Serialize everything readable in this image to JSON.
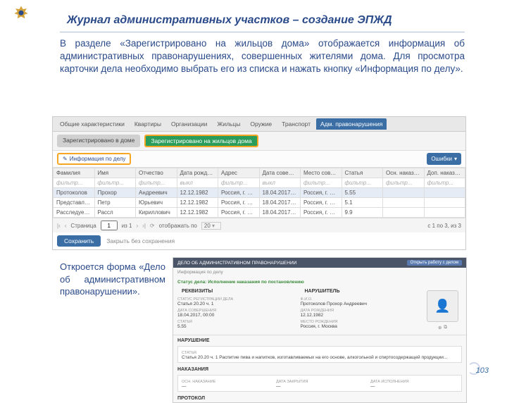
{
  "page": {
    "title": "Журнал административных участков – создание ЭПЖД",
    "number": "103"
  },
  "intro": "В разделе «Зарегистрировано на жильцов дома» отображается информация об  административных правонарушениях, совершенных жителями дома. Для просмотра карточки дела необходимо выбрать его из списка и нажать кнопку «Информация по делу».",
  "desc2": "Откроется форма «Дело об административном правонарушении».",
  "shot1": {
    "tabs": [
      "Общие характеристики",
      "Квартиры",
      "Организации",
      "Жильцы",
      "Оружие",
      "Транспорт",
      "Адм. правонарушения"
    ],
    "activeTab": 6,
    "subtabs": [
      "Зарегистрировано в доме",
      "Зарегистрировано на жильцов дома"
    ],
    "activeSub": 1,
    "infoBtn": "Информация по делу",
    "errBtn": "Ошибки",
    "cols": [
      "Фамилия",
      "Имя",
      "Отчество",
      "Дата рождения",
      "Адрес",
      "Дата соверш...",
      "Место соверш...",
      "Статья",
      "Осн. наказание",
      "Доп. наказание"
    ],
    "filter": "фильтр...",
    "vykl": "выкл",
    "rows": [
      [
        "Протоколов",
        "Прохор",
        "Андреевич",
        "12.12.1982",
        "Россия, г. Мос...",
        "18.04.2017 00:...",
        "Россия, г. Мос...",
        "5.55",
        "",
        ""
      ],
      [
        "Представляю...",
        "Петр",
        "Юрьевич",
        "12.12.1982",
        "Россия, г. Мос...",
        "18.04.2017 00:...",
        "Россия, г. Мос...",
        "5.1",
        "",
        ""
      ],
      [
        "Расследуемый",
        "Рассл",
        "Кириллович",
        "12.12.1982",
        "Россия, г. Мос...",
        "18.04.2017 00:...",
        "Россия, г. Мос...",
        "9.9",
        "",
        ""
      ]
    ],
    "pager": {
      "pageWord": "Страница",
      "page": "1",
      "ofWord": "из 1",
      "showWord": "отображать по",
      "perPage": "20",
      "range": "с 1 по 3, из 3"
    },
    "save": "Сохранить",
    "cancel": "Закрыть без сохранения"
  },
  "shot2": {
    "header": "ДЕЛО ОБ АДМИНИСТРАТИВНОМ ПРАВОНАРУШЕНИИ",
    "headerBtn": "Открыть работу с делом",
    "bread": "Информация по делу",
    "statusLabel": "Статус дела:",
    "statusValue": "Исполнение наказания по постановлению",
    "leftTitle": "РЕКВИЗИТЫ",
    "rightTitle": "НАРУШИТЕЛЬ",
    "left": [
      {
        "l": "СТАТУС РЕГИСТРАЦИИ ДЕЛА",
        "v": "Статья 20.20 ч. 1"
      },
      {
        "l": "ДАТА СОВЕРШЕНИЯ",
        "v": "18.04.2017, 00:00"
      },
      {
        "l": "СТАТЬЯ",
        "v": "5.55"
      }
    ],
    "right": [
      {
        "l": "Ф.И.О.",
        "v": "Протоколов Прохор Андреевич"
      },
      {
        "l": "ДАТА РОЖДЕНИЯ",
        "v": "12.12.1982"
      },
      {
        "l": "МЕСТО РОЖДЕНИЯ",
        "v": "Россия, г. Москва"
      }
    ],
    "violation": {
      "title": "НАРУШЕНИЕ",
      "l": "СТАТЬЯ",
      "v": "Статья 20.20 ч. 1  Распитие пива и напитков, изготавливаемых на его основе, алкогольной и спиртосодержащей продукции..."
    },
    "punishment": {
      "title": "НАКАЗАНИЯ",
      "cols": [
        {
          "l": "Осн. наказание",
          "v": "—"
        },
        {
          "l": "Дата закрытия",
          "v": "—"
        },
        {
          "l": "Дата исполнения",
          "v": "—"
        }
      ]
    },
    "protocol": "ПРОТОКОЛ"
  }
}
